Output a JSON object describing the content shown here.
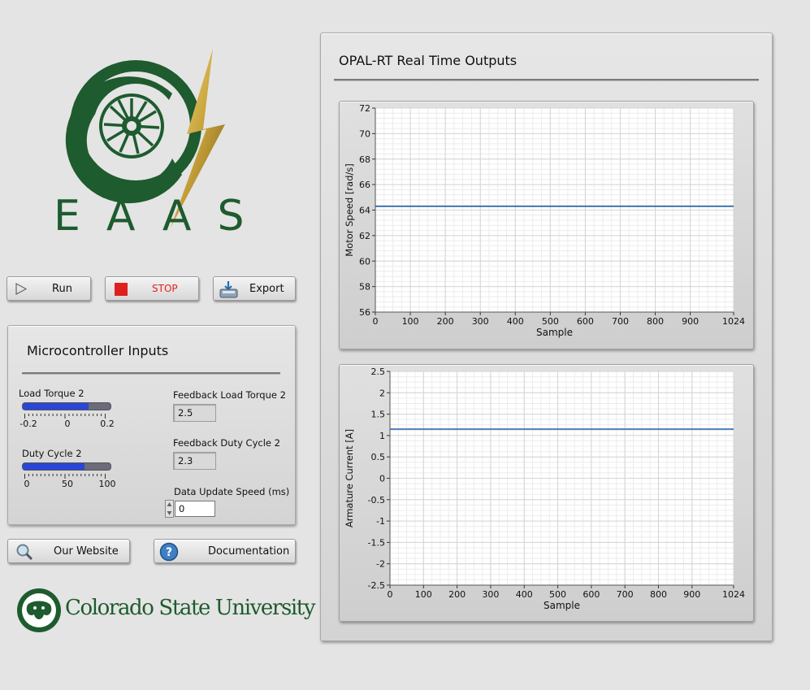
{
  "logo": {
    "text": "EAAS",
    "green": "#1e5b2e",
    "gold": "#c9a43b"
  },
  "controls": {
    "run_label": "Run",
    "stop_label": "STOP",
    "export_label": "Export",
    "stop_color": "#e0201e"
  },
  "micro_inputs": {
    "title": "Microcontroller Inputs",
    "load_torque": {
      "label": "Load Torque 2",
      "min": -0.2,
      "max": 0.2,
      "value": 0.1,
      "ticks": [
        "-0.2",
        "0",
        "0.2"
      ]
    },
    "duty_cycle": {
      "label": "Duty Cycle 2",
      "min": 0,
      "max": 100,
      "value": 70,
      "ticks": [
        "0",
        "50",
        "100"
      ]
    },
    "feedback_load_torque": {
      "label": "Feedback Load Torque 2",
      "value": "2.5"
    },
    "feedback_duty_cycle": {
      "label": "Feedback Duty Cycle 2",
      "value": "2.3"
    },
    "data_update_speed": {
      "label": "Data Update Speed (ms)",
      "value": "0"
    },
    "fill_color": "#2a46d6"
  },
  "links": {
    "website_label": "Our Website",
    "documentation_label": "Documentation"
  },
  "university": {
    "name": "Colorado State University"
  },
  "outputs": {
    "title": "OPAL-RT Real Time Outputs"
  },
  "chart_data": [
    {
      "type": "line",
      "title": "",
      "xlabel": "Sample",
      "ylabel": "Motor Speed [rad/s]",
      "xlim": [
        0,
        1024
      ],
      "ylim": [
        56,
        72
      ],
      "x_ticks": [
        0,
        100,
        200,
        300,
        400,
        500,
        600,
        700,
        800,
        900,
        1024
      ],
      "y_ticks": [
        56,
        58,
        60,
        62,
        64,
        66,
        68,
        70,
        72
      ],
      "y_tick_labels": [
        "56",
        "58",
        "60",
        "62",
        "64",
        "66",
        "68",
        "70",
        "72"
      ],
      "grid": true,
      "series": [
        {
          "x": [
            0,
            1024
          ],
          "y": [
            64.3,
            64.3
          ],
          "color": "#1f5fa8"
        }
      ]
    },
    {
      "type": "line",
      "title": "",
      "xlabel": "Sample",
      "ylabel": "Armature Current [A]",
      "xlim": [
        0,
        1024
      ],
      "ylim": [
        -2.5,
        2.5
      ],
      "x_ticks": [
        0,
        100,
        200,
        300,
        400,
        500,
        600,
        700,
        800,
        900,
        1024
      ],
      "y_ticks": [
        -2.5,
        -2,
        -1.5,
        -1,
        -0.5,
        0,
        0.5,
        1,
        1.5,
        2,
        2.5
      ],
      "y_tick_labels": [
        "-2.5",
        "-2",
        "-1.5",
        "-1",
        "-0.5",
        "0",
        "0.5",
        "1",
        "1.5",
        "2",
        "2.5"
      ],
      "grid": true,
      "series": [
        {
          "x": [
            0,
            1024
          ],
          "y": [
            1.15,
            1.15
          ],
          "color": "#1f5fa8"
        }
      ]
    }
  ]
}
